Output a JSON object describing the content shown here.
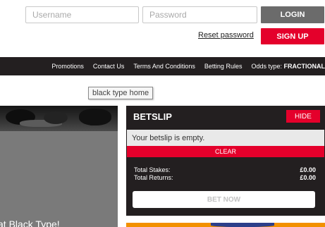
{
  "header": {
    "username_placeholder": "Username",
    "password_placeholder": "Password",
    "login_label": "LOGIN",
    "reset_label": "Reset password",
    "signup_label": "SIGN UP"
  },
  "nav": {
    "items": [
      "Promotions",
      "Contact Us",
      "Terms And Conditions",
      "Betting Rules"
    ],
    "odds_label": "Odds type:",
    "odds_value": "FRACTIONAL"
  },
  "tooltip": {
    "text": "black type home"
  },
  "banner": {
    "text": "at Black Type!"
  },
  "betslip": {
    "title": "BETSLIP",
    "hide_label": "HIDE",
    "empty_message": "Your betslip is empty.",
    "clear_label": "CLEAR",
    "total_stakes_label": "Total Stakes:",
    "total_stakes_value": "£0.00",
    "total_returns_label": "Total Returns:",
    "total_returns_value": "£0.00",
    "bet_now_label": "BET NOW"
  },
  "colors": {
    "accent_red": "#e4002b",
    "dark": "#231f20",
    "login_grey": "#6b6b6b"
  }
}
